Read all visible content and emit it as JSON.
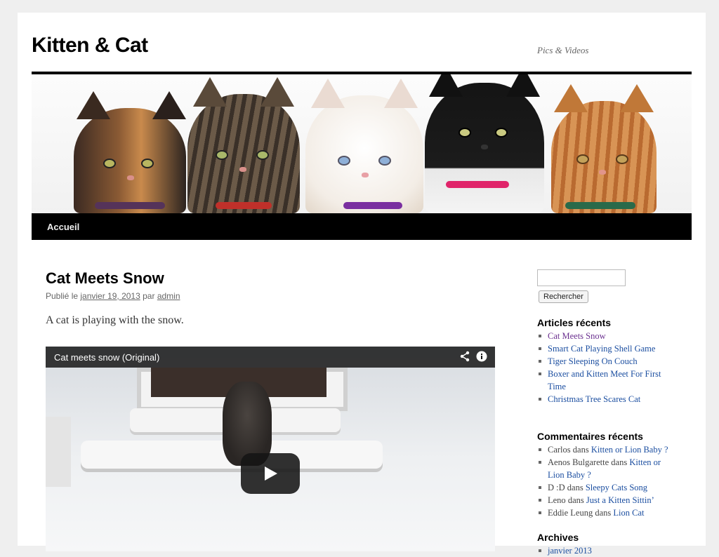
{
  "site": {
    "title": "Kitten & Cat",
    "description": "Pics & Videos"
  },
  "nav": {
    "items": [
      "Accueil"
    ]
  },
  "post": {
    "title": "Cat Meets Snow",
    "meta_prefix": "Publié le",
    "date": "janvier 19, 2013",
    "meta_by": "par",
    "author": "admin",
    "content": "A cat is playing with the snow.",
    "video_title": "Cat meets snow (Original)"
  },
  "sidebar": {
    "search_button": "Rechercher",
    "recent_posts": {
      "title": "Articles récents",
      "items": [
        "Cat Meets Snow",
        "Smart Cat Playing Shell Game",
        "Tiger Sleeping On Couch",
        "Boxer and Kitten Meet For First",
        "Time",
        "Christmas Tree Scares Cat"
      ]
    },
    "recent_comments": {
      "title": "Commentaires récents",
      "connector": "dans",
      "items": [
        {
          "author": "Carlos",
          "post": "Kitten or Lion Baby ?"
        },
        {
          "author": "Aenos Bulgarette",
          "post": "Kitten or"
        },
        {
          "post_cont": "Lion Baby ?"
        },
        {
          "author": "D :D",
          "post": "Sleepy Cats Song"
        },
        {
          "author": "Leno",
          "post": "Just a Kitten Sittin’"
        },
        {
          "author": "Eddie Leung",
          "post": "Lion Cat"
        }
      ]
    },
    "archives": {
      "title": "Archives",
      "items": [
        "janvier 2013"
      ]
    }
  },
  "colors": {
    "link": "#1b4ea0",
    "visited_link": "#6a2f8f",
    "nav_bg": "#000000"
  }
}
